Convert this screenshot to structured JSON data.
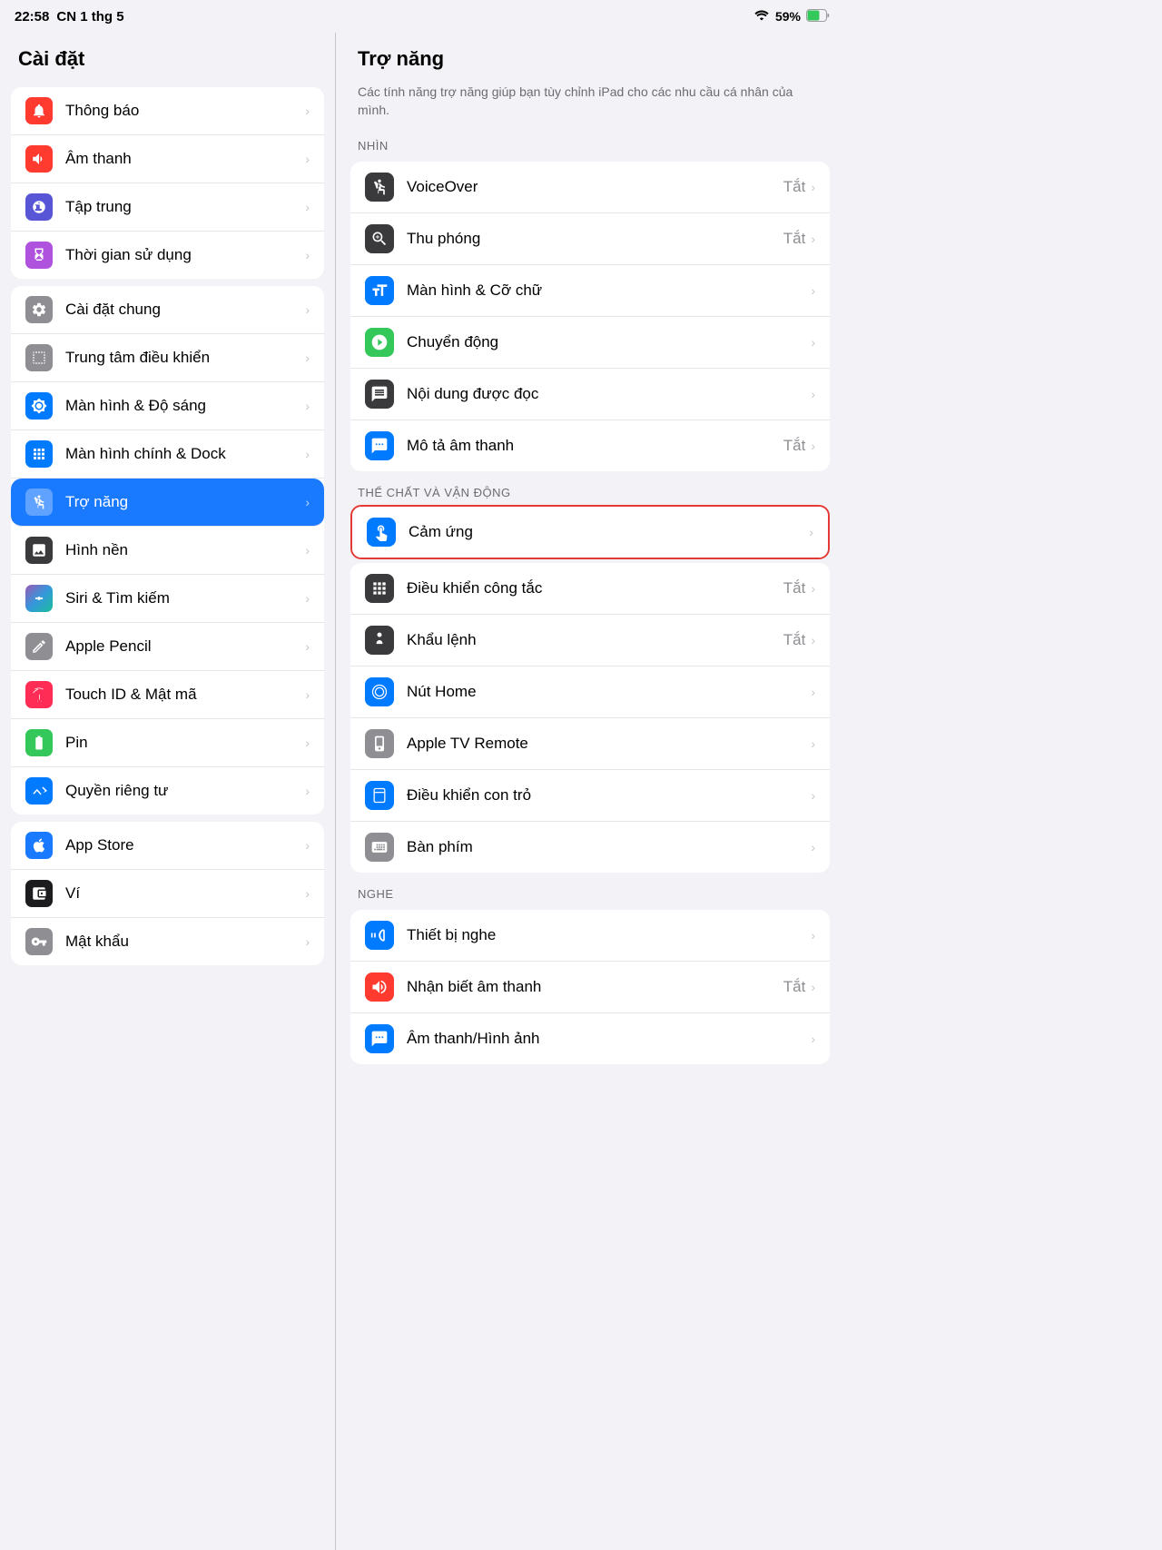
{
  "statusBar": {
    "time": "22:58",
    "date": "CN 1 thg 5",
    "wifi": "WiFi",
    "battery": "59%"
  },
  "sidebar": {
    "title": "Cài đặt",
    "groups": [
      {
        "items": [
          {
            "id": "thong-bao",
            "label": "Thông báo",
            "iconBg": "bg-red",
            "icon": "bell"
          },
          {
            "id": "am-thanh",
            "label": "Âm thanh",
            "iconBg": "bg-red",
            "icon": "speaker"
          },
          {
            "id": "tap-trung",
            "label": "Tập trung",
            "iconBg": "bg-indigo",
            "icon": "moon"
          },
          {
            "id": "thoi-gian",
            "label": "Thời gian sử dụng",
            "iconBg": "bg-purple",
            "icon": "hourglass"
          }
        ]
      },
      {
        "items": [
          {
            "id": "cai-dat-chung",
            "label": "Cài đặt chung",
            "iconBg": "bg-gray",
            "icon": "gear"
          },
          {
            "id": "trung-tam",
            "label": "Trung tâm điều khiển",
            "iconBg": "bg-gray",
            "icon": "sliders"
          },
          {
            "id": "man-hinh-do-sang",
            "label": "Màn hình & Độ sáng",
            "iconBg": "bg-blue",
            "icon": "brightness"
          },
          {
            "id": "man-hinh-chinh",
            "label": "Màn hình chính & Dock",
            "iconBg": "bg-blue",
            "icon": "grid"
          },
          {
            "id": "tro-nang",
            "label": "Trợ năng",
            "iconBg": "bg-light-blue",
            "icon": "accessibility",
            "active": true
          },
          {
            "id": "hinh-nen",
            "label": "Hình nền",
            "iconBg": "bg-dark",
            "icon": "photo"
          },
          {
            "id": "siri",
            "label": "Siri & Tìm kiếm",
            "iconBg": "bg-dark",
            "icon": "siri"
          },
          {
            "id": "apple-pencil",
            "label": "Apple Pencil",
            "iconBg": "bg-gray",
            "icon": "pencil"
          },
          {
            "id": "touch-id",
            "label": "Touch ID & Mật mã",
            "iconBg": "bg-pink",
            "icon": "fingerprint"
          },
          {
            "id": "pin",
            "label": "Pin",
            "iconBg": "bg-green",
            "icon": "battery"
          },
          {
            "id": "quyen-rieng",
            "label": "Quyền riêng tư",
            "iconBg": "bg-blue",
            "icon": "hand"
          }
        ]
      },
      {
        "items": [
          {
            "id": "app-store",
            "label": "App Store",
            "iconBg": "bg-app-store",
            "icon": "appstore"
          },
          {
            "id": "vi",
            "label": "Ví",
            "iconBg": "bg-wallet",
            "icon": "wallet"
          },
          {
            "id": "mat-khau",
            "label": "Mật khẩu",
            "iconBg": "bg-key",
            "icon": "key"
          }
        ]
      }
    ]
  },
  "content": {
    "title": "Trợ năng",
    "description": "Các tính năng trợ năng giúp bạn tùy chỉnh iPad cho các nhu cầu cá nhân của mình.",
    "sections": [
      {
        "label": "NHÌN",
        "items": [
          {
            "id": "voiceover",
            "label": "VoiceOver",
            "value": "Tắt",
            "icon": "voiceover",
            "iconBg": "bg-dark"
          },
          {
            "id": "thu-phong",
            "label": "Thu phóng",
            "value": "Tắt",
            "icon": "zoom",
            "iconBg": "bg-dark"
          },
          {
            "id": "man-hinh-co-chu",
            "label": "Màn hình & Cỡ chữ",
            "value": "",
            "icon": "textsize",
            "iconBg": "bg-blue"
          },
          {
            "id": "chuyen-dong",
            "label": "Chuyển động",
            "value": "",
            "icon": "motion",
            "iconBg": "bg-green"
          },
          {
            "id": "noi-dung-doc",
            "label": "Nội dung được đọc",
            "value": "",
            "icon": "readdoc",
            "iconBg": "bg-dark"
          },
          {
            "id": "mo-ta-am-thanh",
            "label": "Mô tả âm thanh",
            "value": "Tắt",
            "icon": "audiodesc",
            "iconBg": "bg-blue"
          }
        ]
      },
      {
        "label": "THỂ CHẤT VÀ VẬN ĐỘNG",
        "items": [
          {
            "id": "cam-ung",
            "label": "Cảm ứng",
            "value": "",
            "icon": "touch",
            "iconBg": "bg-blue",
            "highlighted": true
          },
          {
            "id": "dieu-khien-cong-tac",
            "label": "Điều khiển công tắc",
            "value": "Tắt",
            "icon": "switch",
            "iconBg": "bg-dark"
          },
          {
            "id": "khau-lenh",
            "label": "Khẩu lệnh",
            "value": "Tắt",
            "icon": "voice",
            "iconBg": "bg-dark"
          },
          {
            "id": "nut-home",
            "label": "Nút Home",
            "value": "",
            "icon": "home",
            "iconBg": "bg-blue"
          },
          {
            "id": "apple-tv-remote",
            "label": "Apple TV Remote",
            "value": "",
            "icon": "remote",
            "iconBg": "bg-gray"
          },
          {
            "id": "dieu-khien-con-tro",
            "label": "Điều khiển con trỏ",
            "value": "",
            "icon": "pointer",
            "iconBg": "bg-blue"
          },
          {
            "id": "ban-phim",
            "label": "Bàn phím",
            "value": "",
            "icon": "keyboard",
            "iconBg": "bg-gray"
          }
        ]
      },
      {
        "label": "NGHE",
        "items": [
          {
            "id": "thiet-bi-nghe",
            "label": "Thiết bị nghe",
            "value": "",
            "icon": "hearing",
            "iconBg": "bg-blue"
          },
          {
            "id": "nhan-biet-am-thanh",
            "label": "Nhận biết âm thanh",
            "value": "Tắt",
            "icon": "soundrec",
            "iconBg": "bg-red"
          },
          {
            "id": "am-thanh-hinh-anh",
            "label": "Âm thanh/Hình ảnh",
            "value": "",
            "icon": "subtitles",
            "iconBg": "bg-blue"
          }
        ]
      }
    ]
  }
}
